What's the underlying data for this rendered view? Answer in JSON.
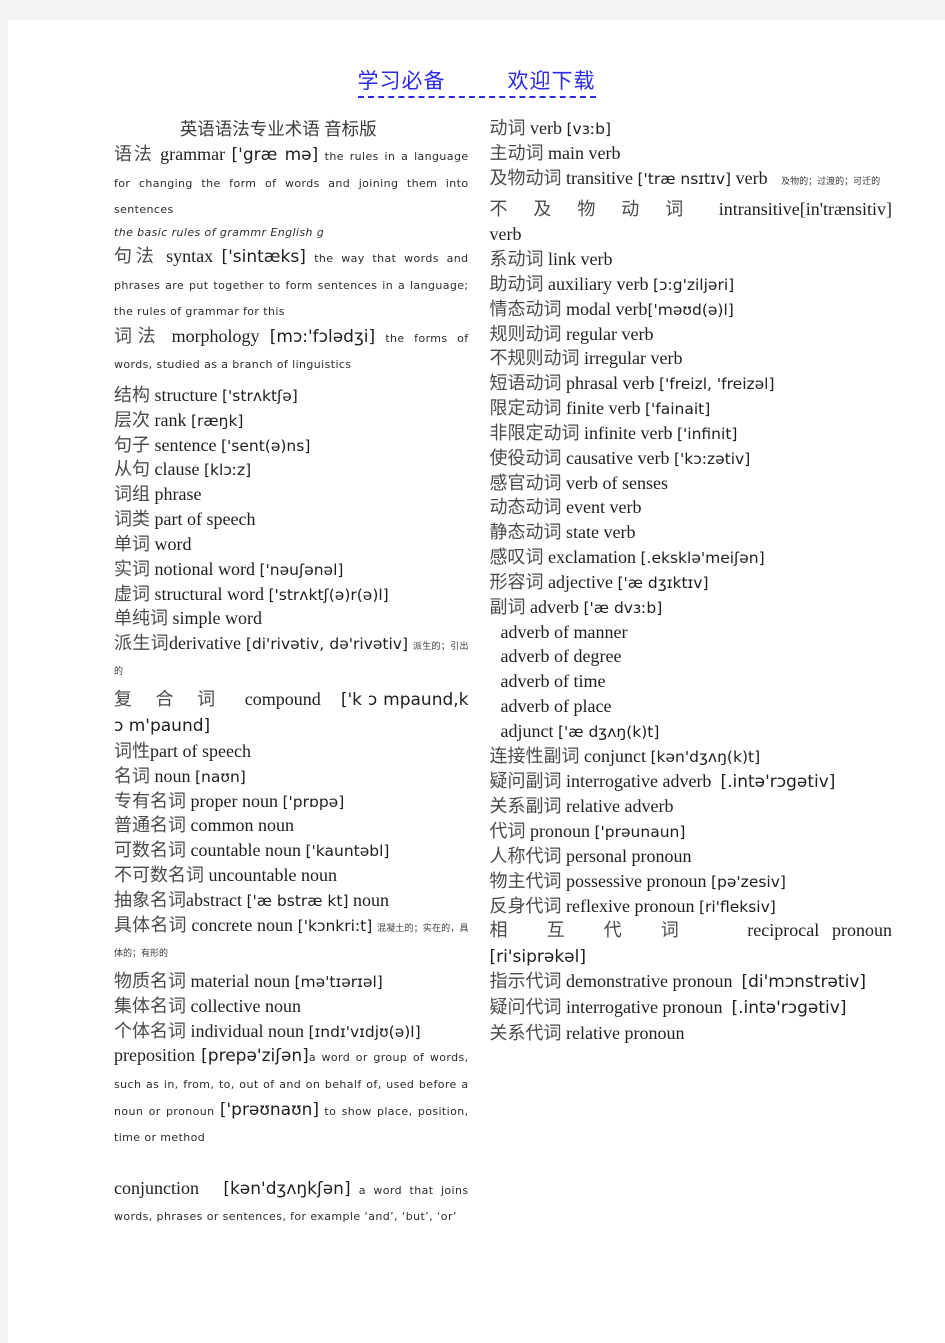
{
  "watermark": {
    "left": "学习必备",
    "right": "欢迎下载",
    "color": "#2a2ae8"
  },
  "document": {
    "title": "英语语法专业术语  音标版"
  },
  "left_column": [
    {
      "type": "entry",
      "cn": "语法",
      "en": "grammar",
      "ipa": "['græ mə]",
      "def": "the rules in a language for changing the form of words and joining them into sentences"
    },
    {
      "type": "def_italic",
      "text": "the basic rules of grammr English g"
    },
    {
      "type": "entry",
      "cn": "句法",
      "en": "syntax",
      "ipa": "['sintæks]",
      "def": "the way that words and phrases are put together to form sentences in a language; the rules of grammar for this"
    },
    {
      "type": "entry",
      "cn": "词法",
      "en": "morphology",
      "ipa": "[mɔ:'fɔlədʒi]",
      "def_pre": "the forms of words, studied as a branch of ",
      "def_link": "linguistics"
    },
    {
      "type": "simple",
      "cn": "结构",
      "en": "structure",
      "ipa": "['strʌktʃə]"
    },
    {
      "type": "simple",
      "cn": "层次",
      "en": "rank",
      "ipa": "[ræŋk]"
    },
    {
      "type": "simple",
      "cn": "句子",
      "en": "sentence",
      "ipa": "['sent(ə)ns]"
    },
    {
      "type": "simple",
      "cn": "从句",
      "en": "clause",
      "ipa": "[klɔːz]"
    },
    {
      "type": "simple",
      "cn": "词组",
      "en": "phrase",
      "ipa": ""
    },
    {
      "type": "simple",
      "cn": "词类",
      "en": "part of speech",
      "ipa": ""
    },
    {
      "type": "simple",
      "cn": "单词",
      "en": "word",
      "ipa": ""
    },
    {
      "type": "simple",
      "cn": "实词",
      "en": "notional word",
      "ipa": "['nəuʃənəl]"
    },
    {
      "type": "simple",
      "cn": "虚词",
      "en": "structural word",
      "ipa": "['strʌktʃ(ə)r(ə)l]"
    },
    {
      "type": "simple",
      "cn": "单纯词",
      "en": "simple word",
      "ipa": ""
    },
    {
      "type": "entry_cn_note",
      "cn": "派生词",
      "en": "derivative",
      "ipa": "[di'rivətiv, də'rivətiv]",
      "note": "派生的；引出的"
    },
    {
      "type": "justified",
      "cn": "复 合 词",
      "en": "compound",
      "ipa": "['k ɔ mpaund,k ɔ m'paund]"
    },
    {
      "type": "simple",
      "cn": "词性",
      "en": "part of speech",
      "ipa": ""
    },
    {
      "type": "simple",
      "cn": "名词",
      "en": "noun",
      "ipa": "[naʊn]"
    },
    {
      "type": "simple",
      "cn": "专有名词",
      "en": "proper noun",
      "ipa": "['prɒpə]"
    },
    {
      "type": "simple",
      "cn": "普通名词",
      "en": "common noun",
      "ipa": ""
    },
    {
      "type": "simple",
      "cn": "可数名词",
      "en": "countable noun",
      "ipa": "['kauntəbl]"
    },
    {
      "type": "simple",
      "cn": "不可数名词",
      "en": "uncountable noun",
      "ipa": ""
    },
    {
      "type": "simple_mid",
      "cn": "抽象名词",
      "en": "abstract",
      "ipa": "['æ bstræ kt]",
      "en_tail": "noun"
    },
    {
      "type": "entry_cn_note",
      "cn": "具体名词",
      "en": "concrete noun",
      "ipa": "['kɔnkri:t]",
      "note": "混凝土的；实在的，具体的；有形的"
    },
    {
      "type": "simple",
      "cn": "物质名词",
      "en": "material noun",
      "ipa": "[mə'tɪərɪəl]"
    },
    {
      "type": "simple",
      "cn": "集体名词",
      "en": "collective noun",
      "ipa": ""
    },
    {
      "type": "simple",
      "cn": "个体名词",
      "en": "individual noun",
      "ipa": "[ɪndɪ'vɪdjʊ(ə)l]"
    },
    {
      "type": "prep_block",
      "en": "preposition",
      "ipa": "[prepə'ziʃən]",
      "def_1": "a word or group of words, such as ",
      "def_i1": "in, from, to, out of",
      "def_2": " and ",
      "def_i2": "on behalf of",
      "def_3": ", used before a noun or pronoun ",
      "ipa_2": "['prəʊnaʊn]",
      "def_4": " to show place, position, time or method"
    },
    {
      "type": "conj_block",
      "en": "conjunction",
      "ipa": "[kən'dʒʌŋkʃən]",
      "def": "a word that joins words, phrases or sentences, for example ‘and’, ‘but’, ‘or’"
    }
  ],
  "right_column": [
    {
      "type": "simple",
      "cn": "动词",
      "en": "verb",
      "ipa": "[vɜːb]"
    },
    {
      "type": "simple",
      "cn": "主动词",
      "en": "main verb",
      "ipa": ""
    },
    {
      "type": "entry_cn_note",
      "cn": "及物动词",
      "en": "transitive",
      "ipa": "['træ nsɪtɪv]",
      "en_tail": "verb",
      "note": "及物的；过渡的；可迁的"
    },
    {
      "type": "justified_wrap",
      "cn": "不 及 物 动 词",
      "en": "intransitive[in'trænsitiv] verb"
    },
    {
      "type": "simple",
      "cn": "系动词",
      "en": "link verb",
      "ipa": ""
    },
    {
      "type": "simple",
      "cn": "助动词",
      "en": "auxiliary verb",
      "ipa": "[ɔ:g'ziljəri]"
    },
    {
      "type": "simple_nospace",
      "cn": "情态动词",
      "en": "modal verb",
      "ipa": "['məʊd(ə)l]"
    },
    {
      "type": "simple",
      "cn": "规则动词",
      "en": "regular verb",
      "ipa": ""
    },
    {
      "type": "simple",
      "cn": "不规则动词",
      "en": "irregular verb",
      "ipa": ""
    },
    {
      "type": "simple",
      "cn": "短语动词",
      "en": "phrasal verb",
      "ipa": "['freizl, 'freizəl]"
    },
    {
      "type": "simple",
      "cn": "限定动词",
      "en": "finite verb",
      "ipa": "['fainait]"
    },
    {
      "type": "simple",
      "cn": "非限定动词",
      "en": "infinite verb",
      "ipa": "['infinit]"
    },
    {
      "type": "simple",
      "cn": "使役动词",
      "en": "causative verb",
      "ipa": "['kɔ:zətiv]"
    },
    {
      "type": "simple",
      "cn": "感官动词",
      "en": "verb of senses",
      "ipa": ""
    },
    {
      "type": "simple",
      "cn": "动态动词",
      "en": "event verb",
      "ipa": ""
    },
    {
      "type": "simple",
      "cn": "静态动词",
      "en": "state verb",
      "ipa": ""
    },
    {
      "type": "simple",
      "cn": "感叹词",
      "en": "exclamation",
      "ipa": "[.eksklə'meiʃən]"
    },
    {
      "type": "simple",
      "cn": "形容词",
      "en": "adjective",
      "ipa": "['æ dʒɪktɪv]"
    },
    {
      "type": "simple",
      "cn": "副词",
      "en": "adverb",
      "ipa": "['æ dvɜːb]"
    },
    {
      "type": "sub",
      "en": "adverb of manner",
      "ipa": ""
    },
    {
      "type": "sub",
      "en": "adverb of degree",
      "ipa": ""
    },
    {
      "type": "sub",
      "en": "adverb of time",
      "ipa": ""
    },
    {
      "type": "sub",
      "en": "adverb of place",
      "ipa": ""
    },
    {
      "type": "sub",
      "en": "adjunct",
      "ipa": "['æ dʒʌŋ(k)t]"
    },
    {
      "type": "simple",
      "cn": "连接性副词",
      "en": "conjunct",
      "ipa": "[kən'dʒʌŋ(k)t]"
    },
    {
      "type": "justified_wrap2",
      "cn": "疑问副词",
      "en": "interrogative      adverb",
      "ipa": "[.intə'rɔgətiv]"
    },
    {
      "type": "simple",
      "cn": "关系副词",
      "en": "relative adverb",
      "ipa": ""
    },
    {
      "type": "simple",
      "cn": "代词",
      "en": "pronoun",
      "ipa": "['prəunaun]"
    },
    {
      "type": "simple",
      "cn": "人称代词",
      "en": "personal pronoun",
      "ipa": ""
    },
    {
      "type": "simple",
      "cn": "物主代词",
      "en": "possessive pronoun",
      "ipa": "[pə'zesiv]"
    },
    {
      "type": "simple",
      "cn": "反身代词",
      "en": "reflexive pronoun",
      "ipa": "[ri'fleksiv]"
    },
    {
      "type": "justified_wrap2",
      "cn": "相 互 代 词",
      "en": "reciprocal      pronoun",
      "ipa": "[ri'siprəkəl]"
    },
    {
      "type": "justified_wrap2",
      "cn": "指示代词",
      "en": "demonstrative  pronoun",
      "ipa": "[di'mɔnstrətiv]"
    },
    {
      "type": "justified_wrap2",
      "cn": "疑问代词",
      "en": "interrogative  pronoun",
      "ipa": "[.intə'rɔgətiv]"
    },
    {
      "type": "simple",
      "cn": "关系代词",
      "en": "relative pronoun",
      "ipa": ""
    }
  ]
}
